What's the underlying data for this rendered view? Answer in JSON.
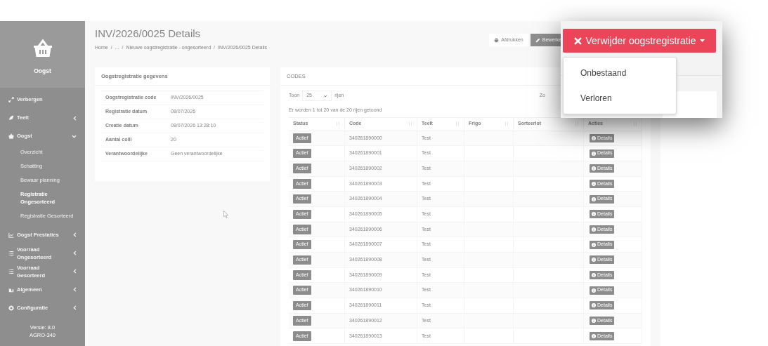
{
  "sidebar": {
    "app_title": "Oogst",
    "items": [
      {
        "label": "Verbergen"
      },
      {
        "label": "Teelt",
        "expanded": false
      },
      {
        "label": "Oogst",
        "expanded": true,
        "children": [
          {
            "label": "Overzicht",
            "selected": false
          },
          {
            "label": "Schatting",
            "selected": false
          },
          {
            "label": "Bewaar planning",
            "selected": false
          },
          {
            "label": "Registratie Ongesorteerd",
            "selected": true
          },
          {
            "label": "Registratie Gesorteerd",
            "selected": false
          }
        ]
      },
      {
        "label": "Oogst Prestaties",
        "expanded": false
      },
      {
        "label": "Voorraad Ongesorteerd",
        "expanded": false
      },
      {
        "label": "Voorraad Gesorteerd",
        "expanded": false
      },
      {
        "label": "Algemeen",
        "expanded": false
      },
      {
        "label": "Configuratie",
        "expanded": false
      }
    ],
    "version": [
      "Versie: 8.0",
      "AGRO-340"
    ]
  },
  "header": {
    "title": "INV/2026/0025 Details",
    "breadcrumb": [
      "Home",
      "...",
      "Nieuwe oogstregistratie - ongesorteerd",
      "INV/2026/0025 Details"
    ],
    "breadcrumb_separator": "/"
  },
  "toolbar": {
    "print": "Afdrukken",
    "edit": "Bewerke",
    "delete": "Verwijder oogstregistratie",
    "delete_menu": [
      "Onbestaand",
      "Verloren"
    ]
  },
  "details": {
    "title": "Oogstregistratie gegevens",
    "fields": [
      {
        "label": "Oogstregistratie code",
        "value": "INV/2026/0025"
      },
      {
        "label": "Registratie datum",
        "value": "08/07/2026"
      },
      {
        "label": "Creatie datum",
        "value": "08/07/2026 13:28:10"
      },
      {
        "label": "Aantal colli",
        "value": "20"
      },
      {
        "label": "Verantwoordelijke",
        "value": "Geen verantwoordelijke"
      }
    ]
  },
  "codes": {
    "title": "CODES",
    "show_label": "Toon",
    "page_size": "25",
    "rows_label": "rijen",
    "search_label": "Zo",
    "info": "Er worden 1 tot 20 van de 20 rijen getoond",
    "table": {
      "columns": [
        "Status",
        "Code",
        "Teelt",
        "Frigo",
        "Sorteerlot",
        "Acties"
      ],
      "rows": [
        {
          "status": "Actief",
          "code": "340261890000",
          "teelt": "Test",
          "action": "Details"
        },
        {
          "status": "Actief",
          "code": "340261890001",
          "teelt": "Test",
          "action": "Details"
        },
        {
          "status": "Actief",
          "code": "340261890002",
          "teelt": "Test",
          "action": "Details"
        },
        {
          "status": "Actief",
          "code": "340261890003",
          "teelt": "Test",
          "action": "Details"
        },
        {
          "status": "Actief",
          "code": "340261890004",
          "teelt": "Test",
          "action": "Details"
        },
        {
          "status": "Actief",
          "code": "340261890005",
          "teelt": "Test",
          "action": "Details"
        },
        {
          "status": "Actief",
          "code": "340261890006",
          "teelt": "Test",
          "action": "Details"
        },
        {
          "status": "Actief",
          "code": "340261890007",
          "teelt": "Test",
          "action": "Details"
        },
        {
          "status": "Actief",
          "code": "340261890008",
          "teelt": "Test",
          "action": "Details"
        },
        {
          "status": "Actief",
          "code": "340261890009",
          "teelt": "Test",
          "action": "Details"
        },
        {
          "status": "Actief",
          "code": "340261890010",
          "teelt": "Test",
          "action": "Details"
        },
        {
          "status": "Actief",
          "code": "340261890011",
          "teelt": "Test",
          "action": "Details"
        },
        {
          "status": "Actief",
          "code": "340261890012",
          "teelt": "Test",
          "action": "Details"
        },
        {
          "status": "Actief",
          "code": "340261890013",
          "teelt": "Test",
          "action": "Details"
        }
      ]
    }
  }
}
